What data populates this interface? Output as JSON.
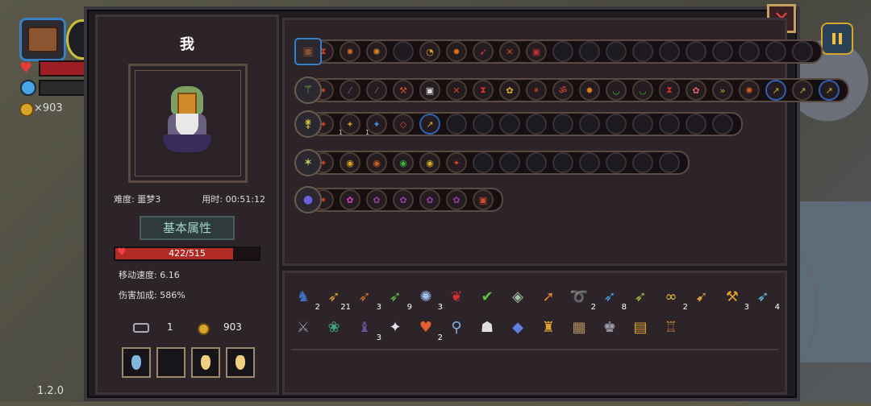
{
  "hud": {
    "coins": "×903",
    "version": "1.2.0"
  },
  "player": {
    "name": "我",
    "difficulty": "难度: 噩梦3",
    "time": "用时: 00:51:12",
    "attr_button": "基本属性",
    "hp_text": "422/515",
    "hp_fraction": 0.819,
    "move_speed": "移动速度: 6.16",
    "damage_bonus": "伤害加成: 586%",
    "keys": "1",
    "coins": "903"
  },
  "potions": [
    {
      "color": "#7fb8e0"
    },
    {
      "color": ""
    },
    {
      "color": "#f0d080"
    },
    {
      "color": "#f0d080"
    }
  ],
  "weapons": [
    {
      "icon": "chest-icon",
      "glyph": "▣",
      "iconColor": "#8a5530",
      "slots": [
        {
          "c": "#c84020",
          "g": "⧗"
        },
        {
          "c": "#d06020",
          "g": "✸"
        },
        {
          "c": "#e08020",
          "g": "✺"
        },
        {
          "c": "",
          "g": ""
        },
        {
          "c": "#e0a020",
          "g": "◔"
        },
        {
          "c": "#e07020",
          "g": "✹"
        },
        {
          "c": "#d04030",
          "g": "➶"
        },
        {
          "c": "#d05020",
          "g": "✕"
        },
        {
          "c": "#c03030",
          "g": "▣"
        },
        {
          "c": "",
          "g": ""
        },
        {
          "c": "",
          "g": ""
        },
        {
          "c": "",
          "g": ""
        },
        {
          "c": "",
          "g": ""
        },
        {
          "c": "",
          "g": ""
        },
        {
          "c": "",
          "g": ""
        },
        {
          "c": "",
          "g": ""
        },
        {
          "c": "",
          "g": ""
        },
        {
          "c": "",
          "g": ""
        },
        {
          "c": "",
          "g": ""
        }
      ]
    },
    {
      "icon": "staff-icon",
      "glyph": "⚚",
      "iconColor": "#70c040",
      "slots": [
        {
          "c": "#c04020",
          "g": "✦",
          "lvl": "1"
        },
        {
          "c": "#8060a0",
          "g": "⁄"
        },
        {
          "c": "#906040",
          "g": "⁄"
        },
        {
          "c": "#d05020",
          "g": "⚒"
        },
        {
          "c": "#e0e0e0",
          "g": "▣"
        },
        {
          "c": "#e04020",
          "g": "✕"
        },
        {
          "c": "#d03030",
          "g": "⧗"
        },
        {
          "c": "#e0b020",
          "g": "✿"
        },
        {
          "c": "#d04020",
          "g": "⏸"
        },
        {
          "c": "#e05030",
          "g": "ॐ"
        },
        {
          "c": "#e08020",
          "g": "✹"
        },
        {
          "c": "#40c040",
          "g": "◡"
        },
        {
          "c": "#50b030",
          "g": "◡"
        },
        {
          "c": "#d03030",
          "g": "⧗"
        },
        {
          "c": "#e06060",
          "g": "✿"
        },
        {
          "c": "#e0a020",
          "g": "»"
        },
        {
          "c": "#d06020",
          "g": "✺"
        },
        {
          "c": "#c0b020",
          "g": "↗",
          "blue": true
        },
        {
          "c": "#a0c030",
          "g": "↗"
        },
        {
          "c": "#d0b020",
          "g": "↗",
          "blue": true
        }
      ]
    },
    {
      "icon": "scepter-icon",
      "glyph": "⚵",
      "iconColor": "#d0c040",
      "slots": [
        {
          "c": "#d04020",
          "g": "✦",
          "lvl": "1"
        },
        {
          "c": "#d09020",
          "g": "✦",
          "lvl": "1"
        },
        {
          "c": "#4090e0",
          "g": "✦",
          "lvl": "1"
        },
        {
          "c": "#e04030",
          "g": "◇"
        },
        {
          "c": "#d0b020",
          "g": "↗",
          "blue": true
        },
        {
          "c": "",
          "g": ""
        },
        {
          "c": "",
          "g": ""
        },
        {
          "c": "",
          "g": ""
        },
        {
          "c": "",
          "g": ""
        },
        {
          "c": "",
          "g": ""
        },
        {
          "c": "",
          "g": ""
        },
        {
          "c": "",
          "g": ""
        },
        {
          "c": "",
          "g": ""
        },
        {
          "c": "",
          "g": ""
        },
        {
          "c": "",
          "g": ""
        },
        {
          "c": "",
          "g": ""
        }
      ]
    },
    {
      "icon": "wand-icon",
      "glyph": "✶",
      "iconColor": "#c0d060",
      "slots": [
        {
          "c": "#d04020",
          "g": "✦",
          "lvl": "1"
        },
        {
          "c": "#e0a020",
          "g": "◉"
        },
        {
          "c": "#d06020",
          "g": "◉"
        },
        {
          "c": "#40b040",
          "g": "◉"
        },
        {
          "c": "#d0b020",
          "g": "◉"
        },
        {
          "c": "#d04020",
          "g": "✦"
        },
        {
          "c": "",
          "g": ""
        },
        {
          "c": "",
          "g": ""
        },
        {
          "c": "",
          "g": ""
        },
        {
          "c": "",
          "g": ""
        },
        {
          "c": "",
          "g": ""
        },
        {
          "c": "",
          "g": ""
        },
        {
          "c": "",
          "g": ""
        },
        {
          "c": "",
          "g": ""
        }
      ]
    },
    {
      "icon": "orb-icon",
      "glyph": "●",
      "iconColor": "#6a60e0",
      "slots": [
        {
          "c": "#d04020",
          "g": "✦",
          "lvl": "1"
        },
        {
          "c": "#d040c0",
          "g": "✿"
        },
        {
          "c": "#9040a0",
          "g": "✿"
        },
        {
          "c": "#9040a0",
          "g": "✿"
        },
        {
          "c": "#9040a0",
          "g": "✿"
        },
        {
          "c": "#9040a0",
          "g": "✿"
        },
        {
          "c": "#d05030",
          "g": "▣"
        }
      ]
    }
  ],
  "inventory": [
    [
      {
        "g": "♞",
        "c": "#4070c0",
        "n": "2"
      },
      {
        "g": "➶",
        "c": "#e0a030",
        "n": "21"
      },
      {
        "g": "➶",
        "c": "#d07020",
        "n": "3"
      },
      {
        "g": "➶",
        "c": "#60c040",
        "n": "9"
      },
      {
        "g": "✺",
        "c": "#a0c0f0",
        "n": "3"
      },
      {
        "g": "❦",
        "c": "#d03030",
        "n": ""
      },
      {
        "g": "✔",
        "c": "#60c040",
        "n": ""
      },
      {
        "g": "◈",
        "c": "#a0c0a0",
        "n": ""
      },
      {
        "g": "➚",
        "c": "#e08030",
        "n": ""
      },
      {
        "g": "➰",
        "c": "#4090e0",
        "n": "2"
      },
      {
        "g": "➶",
        "c": "#40a0e0",
        "n": "8"
      },
      {
        "g": "➶",
        "c": "#a0c040",
        "n": ""
      },
      {
        "g": "∞",
        "c": "#e0c040",
        "n": "2"
      },
      {
        "g": "➹",
        "c": "#e0a030",
        "n": ""
      },
      {
        "g": "⚒",
        "c": "#e0a030",
        "n": "3"
      },
      {
        "g": "➶",
        "c": "#60c0e0",
        "n": "4"
      }
    ],
    [
      {
        "g": "⚔",
        "c": "#9090a0",
        "n": ""
      },
      {
        "g": "❀",
        "c": "#40a080",
        "n": ""
      },
      {
        "g": "♝",
        "c": "#7050a0",
        "n": "3"
      },
      {
        "g": "✦",
        "c": "#e0e0f0",
        "n": ""
      },
      {
        "g": "♥",
        "c": "#e06030",
        "n": "2"
      },
      {
        "g": "⚲",
        "c": "#80b0e0",
        "n": ""
      },
      {
        "g": "☗",
        "c": "#e0e0e0",
        "n": ""
      },
      {
        "g": "◆",
        "c": "#6080e0",
        "n": ""
      },
      {
        "g": "♜",
        "c": "#e0a030",
        "n": ""
      },
      {
        "g": "▦",
        "c": "#b09060",
        "n": ""
      },
      {
        "g": "♚",
        "c": "#a0a0b0",
        "n": ""
      },
      {
        "g": "▤",
        "c": "#e0a030",
        "n": ""
      },
      {
        "g": "♖",
        "c": "#c08040",
        "n": ""
      }
    ]
  ]
}
